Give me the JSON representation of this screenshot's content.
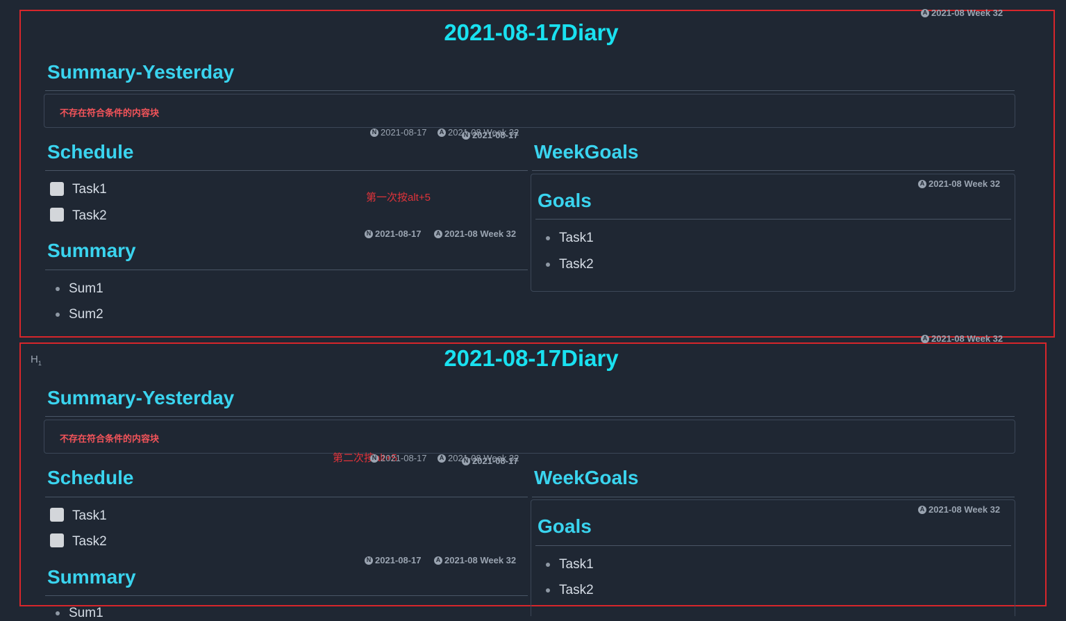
{
  "diary": {
    "title": "2021-08-17Diary",
    "summary_yesterday_heading": "Summary-Yesterday",
    "no_result_text": "不存在符合条件的内容块",
    "schedule_heading": "Schedule",
    "schedule_tasks": [
      "Task1",
      "Task2"
    ],
    "summary_heading": "Summary",
    "summary_items": [
      "Sum1",
      "Sum2"
    ],
    "weekgoals_heading": "WeekGoals",
    "goals_heading": "Goals",
    "goals_items": [
      "Task1",
      "Task2"
    ]
  },
  "meta": {
    "date": "2021-08-17",
    "week": "2021-08 Week 32",
    "badge_daily": "N",
    "badge_weekly": "A"
  },
  "annotations": {
    "first": "第一次按alt+5",
    "second": "第二次按alt+5"
  },
  "heading_marker": "H",
  "heading_marker_sub": "1",
  "colors": {
    "background": "#1f2733",
    "title": "#19e1f0",
    "heading": "#3ad4ef",
    "annotation_box": "#d7262b",
    "no_result": "#f4545a"
  }
}
